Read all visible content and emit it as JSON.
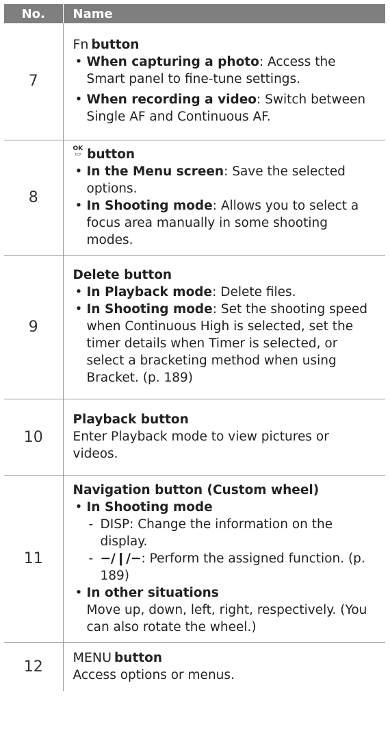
{
  "headers": {
    "no": "No.",
    "name": "Name"
  },
  "rows": [
    {
      "no": "7",
      "title_symbol": "Fn",
      "title": "button",
      "items": [
        {
          "bold": "When capturing a photo",
          "text": ": Access the Smart panel to fine-tune settings."
        },
        {
          "bold": "When recording a video",
          "text": ": Switch between Single AF and Continuous AF."
        }
      ]
    },
    {
      "no": "8",
      "title_icon": "ok-menu-icon",
      "title": "button",
      "items": [
        {
          "bold": "In the Menu screen",
          "text": ": Save the selected options."
        },
        {
          "bold": "In Shooting mode",
          "text": ": Allows you to select a focus area manually in some shooting modes."
        }
      ]
    },
    {
      "no": "9",
      "title": "Delete button",
      "items": [
        {
          "bold": "In Playback mode",
          "text": ": Delete files."
        },
        {
          "bold": "In Shooting mode",
          "text": ": Set the shooting speed when Continuous High is selected, set the timer details when Timer is selected, or select a bracketing method when using Bracket. (p. 189)"
        }
      ]
    },
    {
      "no": "10",
      "title": "Playback button",
      "text": "Enter Playback mode to view pictures or videos."
    },
    {
      "no": "11",
      "title": "Navigation button (Custom wheel)",
      "item1_bold": "In Shooting mode",
      "sub": [
        {
          "symbol": "DISP",
          "text": ": Change the information on the display."
        },
        {
          "symbol": "−/❙/−",
          "text": ": Perform the assigned function. (p. 189)"
        }
      ],
      "item2_bold": "In other situations",
      "item2_text": "Move up, down, left, right, respectively. (You can also rotate the wheel.)"
    },
    {
      "no": "12",
      "title_symbol": "MENU",
      "title": "button",
      "text": "Access options or menus."
    }
  ]
}
